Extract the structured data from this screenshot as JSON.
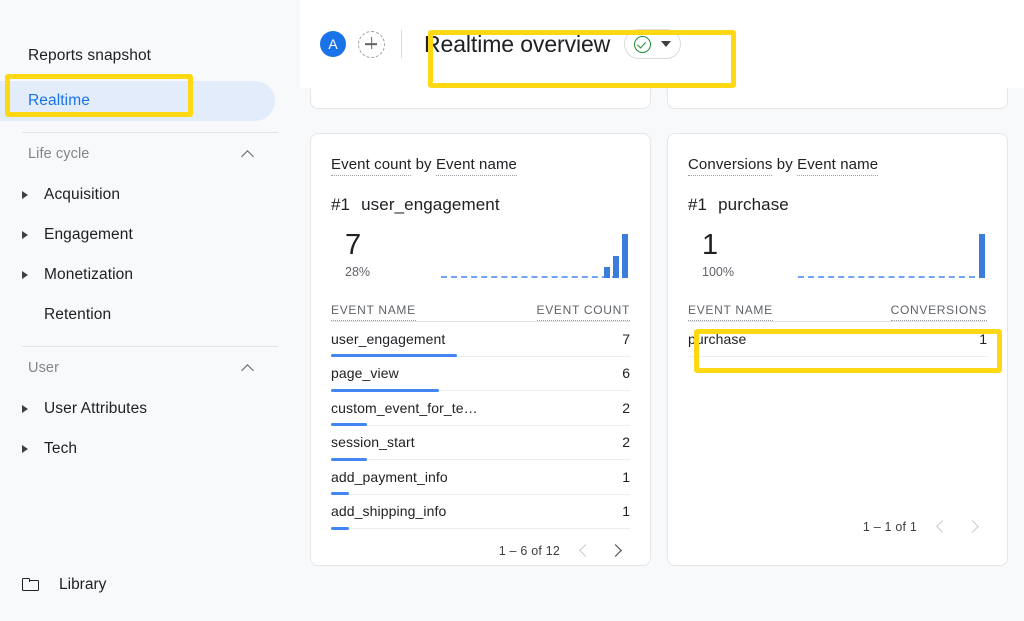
{
  "sidebar": {
    "reports_snapshot": "Reports snapshot",
    "realtime": "Realtime",
    "sections": [
      {
        "title": "Life cycle",
        "collapse_icon": "chevron-up-icon",
        "items": [
          {
            "label": "Acquisition",
            "expandable": true
          },
          {
            "label": "Engagement",
            "expandable": true
          },
          {
            "label": "Monetization",
            "expandable": true
          },
          {
            "label": "Retention",
            "expandable": false
          }
        ]
      },
      {
        "title": "User",
        "collapse_icon": "chevron-up-icon",
        "items": [
          {
            "label": "User Attributes",
            "expandable": true
          },
          {
            "label": "Tech",
            "expandable": true
          }
        ]
      }
    ],
    "library": {
      "label": "Library",
      "icon": "folder-icon"
    }
  },
  "topbar": {
    "avatar_initial": "A",
    "add_icon": "plus-circle-dashed-icon",
    "title": "Realtime overview",
    "status_icon": "check-circle-icon",
    "dropdown_icon": "caret-down-icon",
    "accent_color": "#1a73e8",
    "status_color": "#1e8e3e"
  },
  "cards": [
    {
      "title_metric": "Event count",
      "title_by": "by",
      "title_dimension": "Event name",
      "rank": "#1",
      "rank_name": "user_engagement",
      "big_value": "7",
      "big_pct": "28%",
      "sparkline": {
        "values": [
          1,
          2,
          4
        ],
        "max": 4,
        "color": "#3b7ddd"
      },
      "col_name": "EVENT NAME",
      "col_value": "EVENT COUNT",
      "rows": [
        {
          "name": "user_engagement",
          "value": "7"
        },
        {
          "name": "page_view",
          "value": "6"
        },
        {
          "name": "custom_event_for_te…",
          "value": "2"
        },
        {
          "name": "session_start",
          "value": "2"
        },
        {
          "name": "add_payment_info",
          "value": "1"
        },
        {
          "name": "add_shipping_info",
          "value": "1"
        }
      ],
      "pager": {
        "range": "1 – 6 of 12",
        "prev_enabled": false,
        "next_enabled": true
      }
    },
    {
      "title_metric": "Conversions",
      "title_by": "by",
      "title_dimension": "Event name",
      "rank": "#1",
      "rank_name": "purchase",
      "big_value": "1",
      "big_pct": "100%",
      "sparkline": {
        "values": [
          4
        ],
        "max": 4,
        "color": "#3b7ddd"
      },
      "col_name": "EVENT NAME",
      "col_value": "CONVERSIONS",
      "rows": [
        {
          "name": "purchase",
          "value": "1"
        }
      ],
      "pager": {
        "range": "1 – 1 of 1",
        "prev_enabled": false,
        "next_enabled": false
      }
    }
  ],
  "chart_data": [
    {
      "type": "bar",
      "title": "Event count by Event name",
      "categories": [
        "user_engagement",
        "page_view",
        "custom_event_for_te…",
        "session_start",
        "add_payment_info",
        "add_shipping_info"
      ],
      "values": [
        7,
        6,
        2,
        2,
        1,
        1
      ],
      "xlabel": "EVENT NAME",
      "ylabel": "EVENT COUNT",
      "total_categories": 12,
      "top_value": 7,
      "top_share_pct": 28,
      "sparkline": [
        1,
        2,
        4
      ]
    },
    {
      "type": "bar",
      "title": "Conversions by Event name",
      "categories": [
        "purchase"
      ],
      "values": [
        1
      ],
      "xlabel": "EVENT NAME",
      "ylabel": "CONVERSIONS",
      "total_categories": 1,
      "top_value": 1,
      "top_share_pct": 100,
      "sparkline": [
        4
      ]
    }
  ],
  "highlights": {
    "realtime_box": "yellow-highlight-realtime",
    "title_box": "yellow-highlight-title",
    "purchase_box": "yellow-highlight-purchase"
  }
}
